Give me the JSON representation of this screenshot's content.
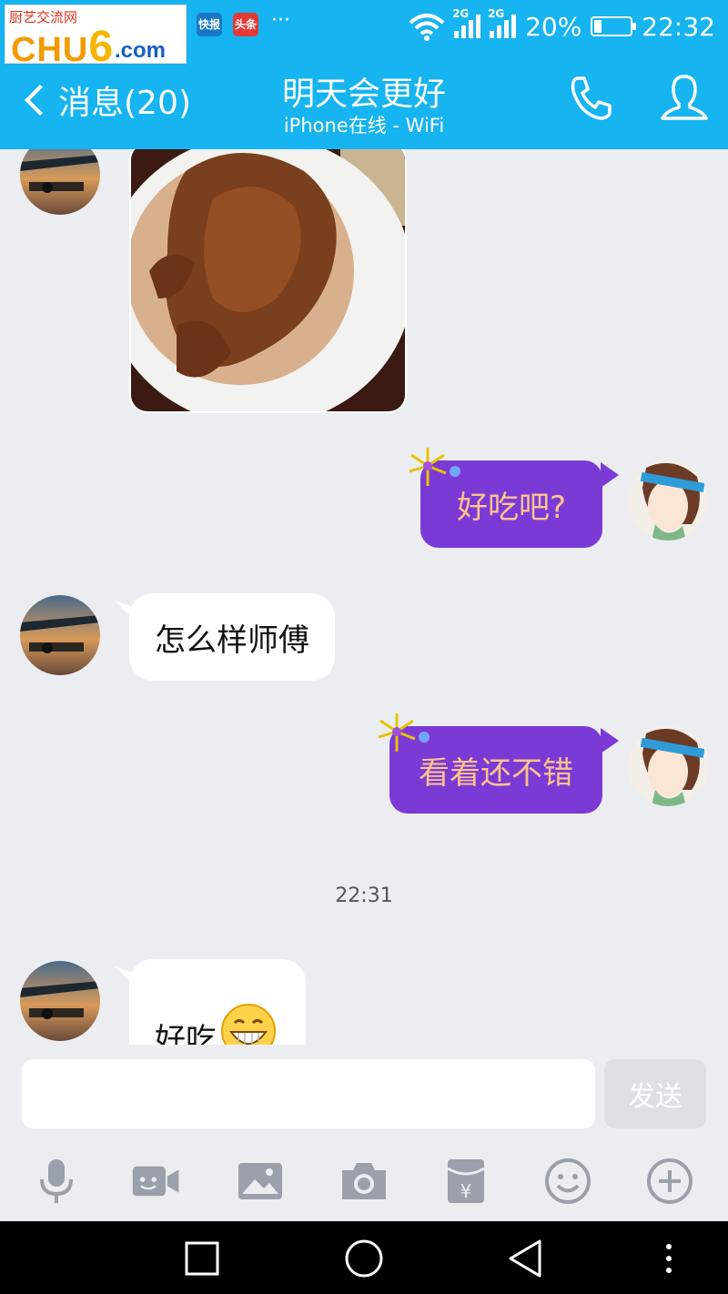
{
  "status_bar": {
    "watermark": {
      "top_text": "厨艺交流网",
      "brand_a": "CHU",
      "brand_b": "6",
      "brand_c": ".com"
    },
    "app_icons": [
      "快报",
      "头条"
    ],
    "more": "···",
    "signal_label_1": "2G",
    "signal_label_2": "2G",
    "battery_percent": "20%",
    "battery_level": 0.2,
    "time": "22:32"
  },
  "header": {
    "back_label": "消息(20)",
    "chat_name": "明天会更好",
    "chat_status": "iPhone在线 - WiFi",
    "phone_icon": "phone-icon",
    "profile_icon": "profile-icon",
    "accent_color": "#16b4f0"
  },
  "messages": {
    "m2_text": "好吃吧?",
    "m3_text": "怎么样师傅",
    "m4_text": "看着还不错",
    "timestamp": "22:31",
    "m5_text": "好吃",
    "bubble_purple_color": "#7b3ad6"
  },
  "input": {
    "value": "",
    "placeholder": "",
    "send_label": "发送"
  },
  "toolbar": {
    "icons": [
      "microphone-icon",
      "video-icon",
      "image-icon",
      "camera-icon",
      "red-packet-icon",
      "emoji-icon",
      "plus-icon"
    ]
  },
  "nav": {
    "icons": [
      "recents-icon",
      "home-icon",
      "back-icon",
      "menu-icon"
    ]
  }
}
